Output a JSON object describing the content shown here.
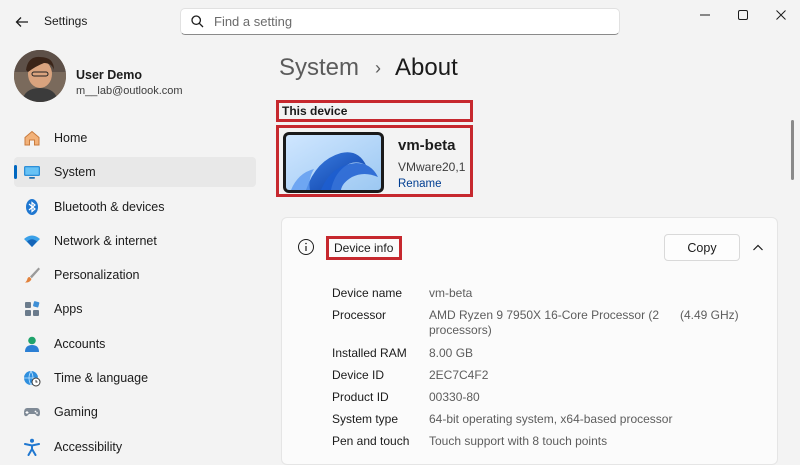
{
  "titlebar": {
    "app_title": "Settings",
    "search_placeholder": "Find a setting"
  },
  "profile": {
    "name": "User Demo",
    "email": "m__lab@outlook.com"
  },
  "sidebar": {
    "items": [
      {
        "label": "Home",
        "icon": "home-icon",
        "active": false
      },
      {
        "label": "System",
        "icon": "system-icon",
        "active": true
      },
      {
        "label": "Bluetooth & devices",
        "icon": "bluetooth-icon",
        "active": false
      },
      {
        "label": "Network & internet",
        "icon": "wifi-icon",
        "active": false
      },
      {
        "label": "Personalization",
        "icon": "brush-icon",
        "active": false
      },
      {
        "label": "Apps",
        "icon": "apps-icon",
        "active": false
      },
      {
        "label": "Accounts",
        "icon": "account-icon",
        "active": false
      },
      {
        "label": "Time & language",
        "icon": "globe-clock-icon",
        "active": false
      },
      {
        "label": "Gaming",
        "icon": "gamepad-icon",
        "active": false
      },
      {
        "label": "Accessibility",
        "icon": "accessibility-icon",
        "active": false
      }
    ]
  },
  "breadcrumb": {
    "parent": "System",
    "separator": "›",
    "current": "About"
  },
  "device": {
    "section_label": "This device",
    "name": "vm-beta",
    "model": "VMware20,1",
    "rename_label": "Rename"
  },
  "device_info": {
    "title": "Device info",
    "copy_label": "Copy",
    "specs": [
      {
        "label": "Device name",
        "value": "vm-beta",
        "extra": ""
      },
      {
        "label": "Processor",
        "value": "AMD Ryzen 9 7950X 16-Core Processor (2 processors)",
        "extra": "(4.49 GHz)"
      },
      {
        "label": "Installed RAM",
        "value": "8.00 GB",
        "extra": ""
      },
      {
        "label": "Device ID",
        "value": "2EC7C4F2",
        "extra": ""
      },
      {
        "label": "Product ID",
        "value": "00330-80",
        "extra": ""
      },
      {
        "label": "System type",
        "value": "64-bit operating system, x64-based processor",
        "extra": ""
      },
      {
        "label": "Pen and touch",
        "value": "Touch support with 8 touch points",
        "extra": ""
      }
    ]
  },
  "colors": {
    "accent": "#0067c0",
    "highlight_box": "#c6282e",
    "link": "#003e92"
  }
}
